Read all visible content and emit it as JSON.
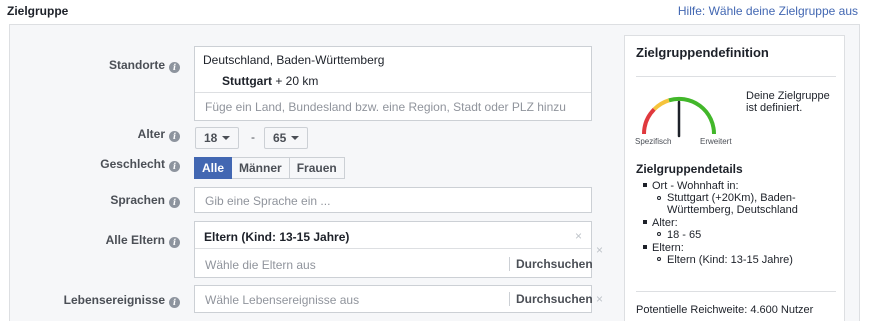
{
  "header": {
    "title": "Zielgruppe",
    "help_link": "Hilfe: Wähle deine Zielgruppe aus"
  },
  "form": {
    "standorte": {
      "label": "Standorte",
      "selected_region": "Deutschland, Baden-Württemberg",
      "city": "Stuttgart",
      "radius": "+ 20 km",
      "placeholder": "Füge ein Land, Bundesland bzw. eine Region, Stadt oder PLZ hinzu"
    },
    "alter": {
      "label": "Alter",
      "min": "18",
      "separator": "-",
      "max": "65"
    },
    "geschlecht": {
      "label": "Geschlecht",
      "options": [
        "Alle",
        "Männer",
        "Frauen"
      ],
      "selected": "Alle"
    },
    "sprachen": {
      "label": "Sprachen",
      "placeholder": "Gib eine Sprache ein ..."
    },
    "eltern": {
      "label": "Alle Eltern",
      "selected": "Eltern (Kind: 13-15 Jahre)",
      "placeholder": "Wähle die Eltern aus",
      "browse": "Durchsuchen",
      "remove": "×",
      "clear": "×"
    },
    "lebensereignisse": {
      "label": "Lebensereignisse",
      "placeholder": "Wähle Lebensereignisse aus",
      "browse": "Durchsuchen",
      "clear": "×"
    }
  },
  "sidebar": {
    "title": "Zielgruppendefinition",
    "gauge": {
      "left_label": "Spezifisch",
      "right_label": "Erweitert",
      "status": "Deine Zielgruppe ist definiert.",
      "needle_fraction": 0.5,
      "colors": {
        "red": "#e0393e",
        "yellow": "#f5c33b",
        "green": "#42b72a",
        "needle": "#1d2129"
      }
    },
    "details_title": "Zielgruppendetails",
    "details": [
      {
        "label": "Ort - Wohnhaft in:",
        "sub": [
          "Stuttgart (+20Km), Baden-Württemberg, Deutschland"
        ]
      },
      {
        "label": "Alter:",
        "sub": [
          "18 - 65"
        ]
      },
      {
        "label": "Eltern:",
        "sub": [
          "Eltern (Kind: 13-15 Jahre)"
        ]
      }
    ],
    "reach": "Potentielle Reichweite: 4.600 Nutzer"
  },
  "colors": {
    "accent": "#4267b2",
    "link": "#4267b2"
  }
}
